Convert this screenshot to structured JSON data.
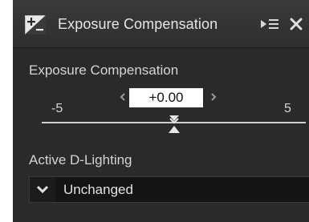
{
  "panel": {
    "title": "Exposure Compensation",
    "icons": {
      "panel": "exposure-plus-minus-icon",
      "menu": "panel-menu-icon",
      "close": "close-icon"
    }
  },
  "exposure": {
    "label": "Exposure Compensation",
    "min_label": "-5",
    "max_label": "5",
    "value": "+0.00",
    "slider_value": 0,
    "slider_min": -5,
    "slider_max": 5
  },
  "adl": {
    "label": "Active D-Lighting",
    "selected": "Unchanged"
  },
  "colors": {
    "panel_bg": "#2a2a2a",
    "text": "#d2d2d2",
    "value_box": "#ffffff"
  }
}
